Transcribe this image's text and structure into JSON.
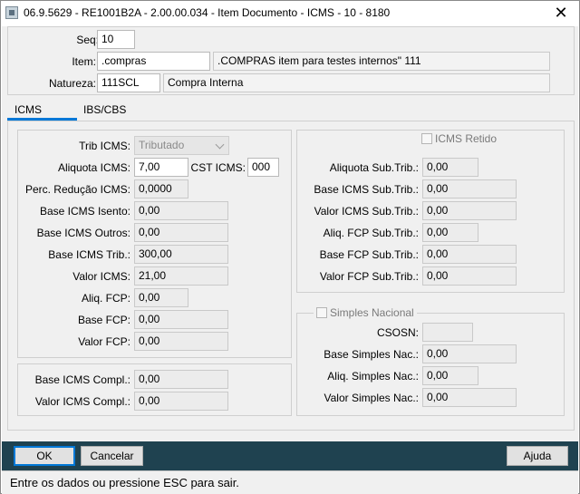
{
  "window": {
    "title": "06.9.5629 - RE1001B2A - 2.00.00.034 - Item Documento - ICMS - 10 - 8180",
    "close_symbol": "✕"
  },
  "header": {
    "seq_label": "Seq:",
    "seq_value": "10",
    "item_label": "Item:",
    "item_code": ".compras",
    "item_desc": ".COMPRAS item para testes internos\" 111",
    "natureza_label": "Natureza:",
    "natureza_code": "111SCL",
    "natureza_desc": "Compra Interna"
  },
  "tabs": [
    {
      "label": "ICMS",
      "active": true
    },
    {
      "label": "IBS/CBS",
      "active": false
    }
  ],
  "icms": {
    "trib_label": "Trib ICMS:",
    "trib_value": "Tributado",
    "aliquota_label": "Aliquota ICMS:",
    "aliquota_value": "7,00",
    "cst_label": "CST ICMS:",
    "cst_value": "000",
    "perc_reducao_label": "Perc. Redução ICMS:",
    "perc_reducao_value": "0,0000",
    "base_isento_label": "Base ICMS Isento:",
    "base_isento_value": "0,00",
    "base_outros_label": "Base ICMS Outros:",
    "base_outros_value": "0,00",
    "base_trib_label": "Base ICMS Trib.:",
    "base_trib_value": "300,00",
    "valor_label": "Valor ICMS:",
    "valor_value": "21,00",
    "aliq_fcp_label": "Aliq. FCP:",
    "aliq_fcp_value": "0,00",
    "base_fcp_label": "Base FCP:",
    "base_fcp_value": "0,00",
    "valor_fcp_label": "Valor FCP:",
    "valor_fcp_value": "0,00"
  },
  "compl": {
    "base_label": "Base ICMS Compl.:",
    "base_value": "0,00",
    "valor_label": "Valor ICMS Compl.:",
    "valor_value": "0,00"
  },
  "retido": {
    "group_label": "ICMS Retido",
    "aliquota_sub_label": "Aliquota Sub.Trib.:",
    "aliquota_sub_value": "0,00",
    "base_sub_label": "Base ICMS Sub.Trib.:",
    "base_sub_value": "0,00",
    "valor_sub_label": "Valor ICMS Sub.Trib.:",
    "valor_sub_value": "0,00",
    "aliq_fcp_sub_label": "Aliq. FCP Sub.Trib.:",
    "aliq_fcp_sub_value": "0,00",
    "base_fcp_sub_label": "Base FCP Sub.Trib.:",
    "base_fcp_sub_value": "0,00",
    "valor_fcp_sub_label": "Valor FCP Sub.Trib.:",
    "valor_fcp_sub_value": "0,00"
  },
  "simples": {
    "group_label": "Simples Nacional",
    "csosn_label": "CSOSN:",
    "csosn_value": "",
    "base_label": "Base Simples Nac.:",
    "base_value": "0,00",
    "aliq_label": "Aliq. Simples Nac.:",
    "aliq_value": "0,00",
    "valor_label": "Valor Simples Nac.:",
    "valor_value": "0,00"
  },
  "buttons": {
    "ok": "OK",
    "cancel": "Cancelar",
    "help": "Ajuda"
  },
  "status": {
    "text": "Entre os dados ou pressione ESC para sair."
  },
  "colors": {
    "accent": "#0078d7",
    "bottombar": "#1f4250"
  }
}
